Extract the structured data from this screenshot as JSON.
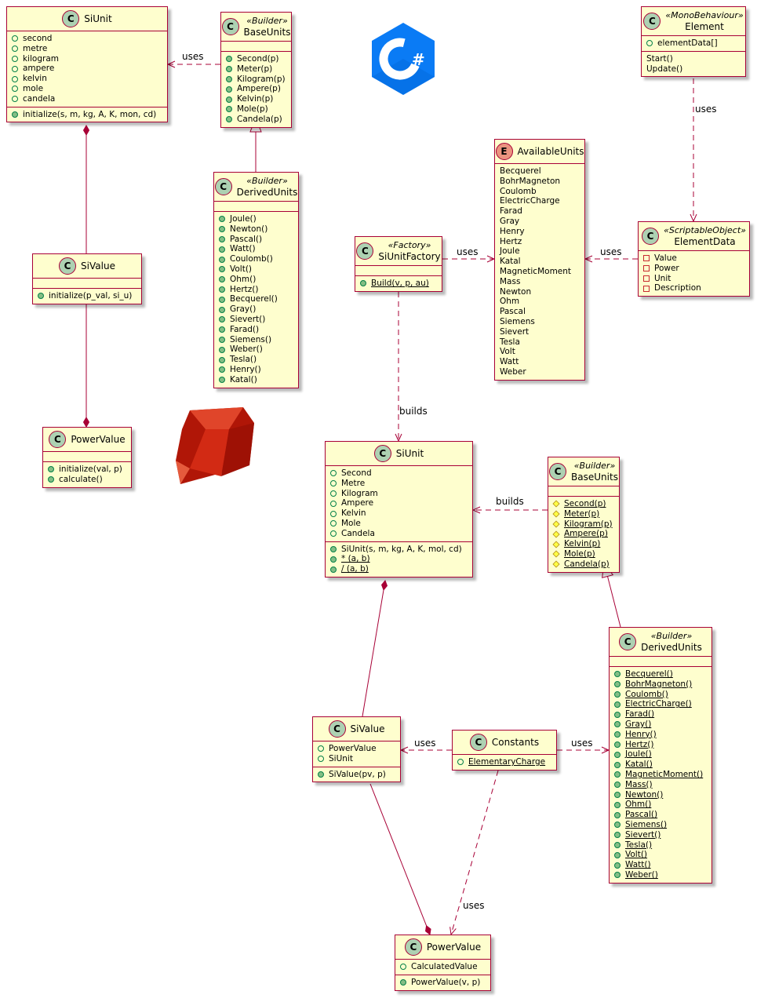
{
  "classes": [
    {
      "id": "ruby-siunit",
      "name": "SiUnit",
      "stereotype": "",
      "kind": "class",
      "fields": [
        {
          "vis": "+f",
          "text": "second"
        },
        {
          "vis": "+f",
          "text": "metre"
        },
        {
          "vis": "+f",
          "text": "kilogram"
        },
        {
          "vis": "+f",
          "text": "ampere"
        },
        {
          "vis": "+f",
          "text": "kelvin"
        },
        {
          "vis": "+f",
          "text": "mole"
        },
        {
          "vis": "+f",
          "text": "candela"
        }
      ],
      "methods": [
        {
          "vis": "+m",
          "text": "initialize(s, m, kg, A, K, mon, cd)"
        }
      ]
    },
    {
      "id": "ruby-baseunits",
      "name": "BaseUnits",
      "stereotype": "«Builder»",
      "kind": "class",
      "fields": null,
      "methods": [
        {
          "vis": "+m",
          "text": "Second(p)"
        },
        {
          "vis": "+m",
          "text": "Meter(p)"
        },
        {
          "vis": "+m",
          "text": "Kilogram(p)"
        },
        {
          "vis": "+m",
          "text": "Ampere(p)"
        },
        {
          "vis": "+m",
          "text": "Kelvin(p)"
        },
        {
          "vis": "+m",
          "text": "Mole(p)"
        },
        {
          "vis": "+m",
          "text": "Candela(p)"
        }
      ]
    },
    {
      "id": "ruby-derivedunits",
      "name": "DerivedUnits",
      "stereotype": "«Builder»",
      "kind": "class",
      "fields": null,
      "methods": [
        {
          "vis": "+m",
          "text": "Joule()"
        },
        {
          "vis": "+m",
          "text": "Newton()"
        },
        {
          "vis": "+m",
          "text": "Pascal()"
        },
        {
          "vis": "+m",
          "text": "Watt()"
        },
        {
          "vis": "+m",
          "text": "Coulomb()"
        },
        {
          "vis": "+m",
          "text": "Volt()"
        },
        {
          "vis": "+m",
          "text": "Ohm()"
        },
        {
          "vis": "+m",
          "text": "Hertz()"
        },
        {
          "vis": "+m",
          "text": "Becquerel()"
        },
        {
          "vis": "+m",
          "text": "Gray()"
        },
        {
          "vis": "+m",
          "text": "Sievert()"
        },
        {
          "vis": "+m",
          "text": "Farad()"
        },
        {
          "vis": "+m",
          "text": "Siemens()"
        },
        {
          "vis": "+m",
          "text": "Weber()"
        },
        {
          "vis": "+m",
          "text": "Tesla()"
        },
        {
          "vis": "+m",
          "text": "Henry()"
        },
        {
          "vis": "+m",
          "text": "Katal()"
        }
      ]
    },
    {
      "id": "ruby-sivalue",
      "name": "SiValue",
      "stereotype": "",
      "kind": "class",
      "fields": null,
      "methods": [
        {
          "vis": "+m",
          "text": "initialize(p_val, si_u)"
        }
      ]
    },
    {
      "id": "ruby-powervalue",
      "name": "PowerValue",
      "stereotype": "",
      "kind": "class",
      "fields": [],
      "methods": [
        {
          "vis": "+m",
          "text": "initialize(val, p)"
        },
        {
          "vis": "+m",
          "text": "calculate()"
        }
      ]
    },
    {
      "id": "element",
      "name": "Element",
      "stereotype": "«MonoBehaviour»",
      "kind": "class",
      "fields": [
        {
          "vis": "+f",
          "text": "elementData[]"
        }
      ],
      "methods": [
        {
          "vis": "",
          "text": "Start()"
        },
        {
          "vis": "",
          "text": "Update()"
        }
      ]
    },
    {
      "id": "availableunits",
      "name": "AvailableUnits",
      "stereotype": "",
      "kind": "enum",
      "fields": [
        {
          "vis": "",
          "text": "Becquerel"
        },
        {
          "vis": "",
          "text": "BohrMagneton"
        },
        {
          "vis": "",
          "text": "Coulomb"
        },
        {
          "vis": "",
          "text": "ElectricCharge"
        },
        {
          "vis": "",
          "text": "Farad"
        },
        {
          "vis": "",
          "text": "Gray"
        },
        {
          "vis": "",
          "text": "Henry"
        },
        {
          "vis": "",
          "text": "Hertz"
        },
        {
          "vis": "",
          "text": "Joule"
        },
        {
          "vis": "",
          "text": "Katal"
        },
        {
          "vis": "",
          "text": "MagneticMoment"
        },
        {
          "vis": "",
          "text": "Mass"
        },
        {
          "vis": "",
          "text": "Newton"
        },
        {
          "vis": "",
          "text": "Ohm"
        },
        {
          "vis": "",
          "text": "Pascal"
        },
        {
          "vis": "",
          "text": "Siemens"
        },
        {
          "vis": "",
          "text": "Sievert"
        },
        {
          "vis": "",
          "text": "Tesla"
        },
        {
          "vis": "",
          "text": "Volt"
        },
        {
          "vis": "",
          "text": "Watt"
        },
        {
          "vis": "",
          "text": "Weber"
        }
      ],
      "methods": null
    },
    {
      "id": "siunitfactory",
      "name": "SiUnitFactory",
      "stereotype": "«Factory»",
      "kind": "class",
      "fields": null,
      "methods": [
        {
          "vis": "+m",
          "text": "Build(v, p, au)",
          "static": true
        }
      ]
    },
    {
      "id": "elementdata",
      "name": "ElementData",
      "stereotype": "«ScriptableObject»",
      "kind": "class",
      "fields": [
        {
          "vis": "-f",
          "text": "Value"
        },
        {
          "vis": "-f",
          "text": "Power"
        },
        {
          "vis": "-f",
          "text": "Unit"
        },
        {
          "vis": "-f",
          "text": "Description"
        }
      ],
      "methods": null
    },
    {
      "id": "cs-siunit",
      "name": "SiUnit",
      "stereotype": "",
      "kind": "class",
      "fields": [
        {
          "vis": "+f",
          "text": "Second"
        },
        {
          "vis": "+f",
          "text": "Metre"
        },
        {
          "vis": "+f",
          "text": "Kilogram"
        },
        {
          "vis": "+f",
          "text": "Ampere"
        },
        {
          "vis": "+f",
          "text": "Kelvin"
        },
        {
          "vis": "+f",
          "text": "Mole"
        },
        {
          "vis": "+f",
          "text": "Candela"
        }
      ],
      "methods": [
        {
          "vis": "+m",
          "text": "SiUnit(s, m, kg, A, K, mol, cd)"
        },
        {
          "vis": "+m",
          "text": "* (a, b)",
          "static": true
        },
        {
          "vis": "+m",
          "text": "/ (a, b)",
          "static": true
        }
      ]
    },
    {
      "id": "cs-baseunits",
      "name": "BaseUnits",
      "stereotype": "«Builder»",
      "kind": "class",
      "fields": null,
      "methods": [
        {
          "vis": "#m",
          "text": "Second(p)",
          "static": true
        },
        {
          "vis": "#m",
          "text": "Meter(p)",
          "static": true
        },
        {
          "vis": "#m",
          "text": "Kilogram(p)",
          "static": true
        },
        {
          "vis": "#m",
          "text": "Ampere(p)",
          "static": true
        },
        {
          "vis": "#m",
          "text": "Kelvin(p)",
          "static": true
        },
        {
          "vis": "#m",
          "text": "Mole(p)",
          "static": true
        },
        {
          "vis": "#m",
          "text": "Candela(p)",
          "static": true
        }
      ]
    },
    {
      "id": "cs-derivedunits",
      "name": "DerivedUnits",
      "stereotype": "«Builder»",
      "kind": "class",
      "fields": null,
      "methods": [
        {
          "vis": "+m",
          "text": "Becquerel()",
          "static": true
        },
        {
          "vis": "+m",
          "text": "BohrMagneton()",
          "static": true
        },
        {
          "vis": "+m",
          "text": "Coulomb()",
          "static": true
        },
        {
          "vis": "+m",
          "text": "ElectricCharge()",
          "static": true
        },
        {
          "vis": "+m",
          "text": "Farad()",
          "static": true
        },
        {
          "vis": "+m",
          "text": "Gray()",
          "static": true
        },
        {
          "vis": "+m",
          "text": "Henry()",
          "static": true
        },
        {
          "vis": "+m",
          "text": "Hertz()",
          "static": true
        },
        {
          "vis": "+m",
          "text": "Joule()",
          "static": true
        },
        {
          "vis": "+m",
          "text": "Katal()",
          "static": true
        },
        {
          "vis": "+m",
          "text": "MagneticMoment()",
          "static": true
        },
        {
          "vis": "+m",
          "text": "Mass()",
          "static": true
        },
        {
          "vis": "+m",
          "text": "Newton()",
          "static": true
        },
        {
          "vis": "+m",
          "text": "Ohm()",
          "static": true
        },
        {
          "vis": "+m",
          "text": "Pascal()",
          "static": true
        },
        {
          "vis": "+m",
          "text": "Siemens()",
          "static": true
        },
        {
          "vis": "+m",
          "text": "Sievert()",
          "static": true
        },
        {
          "vis": "+m",
          "text": "Tesla()",
          "static": true
        },
        {
          "vis": "+m",
          "text": "Volt()",
          "static": true
        },
        {
          "vis": "+m",
          "text": "Watt()",
          "static": true
        },
        {
          "vis": "+m",
          "text": "Weber()",
          "static": true
        }
      ]
    },
    {
      "id": "cs-sivalue",
      "name": "SiValue",
      "stereotype": "",
      "kind": "class",
      "fields": [
        {
          "vis": "+f",
          "text": "PowerValue"
        },
        {
          "vis": "+f",
          "text": "SiUnit"
        }
      ],
      "methods": [
        {
          "vis": "+m",
          "text": "SiValue(pv, p)"
        }
      ]
    },
    {
      "id": "constants",
      "name": "Constants",
      "stereotype": "",
      "kind": "class",
      "fields": [
        {
          "vis": "+f",
          "text": "ElementaryCharge",
          "static": true
        }
      ],
      "methods": null
    },
    {
      "id": "cs-powervalue",
      "name": "PowerValue",
      "stereotype": "",
      "kind": "class",
      "fields": [
        {
          "vis": "+f",
          "text": "CalculatedValue"
        }
      ],
      "methods": [
        {
          "vis": "+m",
          "text": "PowerValue(v, p)"
        }
      ]
    }
  ],
  "edges": [
    {
      "from": "ruby-baseunits",
      "to": "ruby-siunit",
      "type": "dependency",
      "label": "uses"
    },
    {
      "from": "ruby-derivedunits",
      "to": "ruby-baseunits",
      "type": "inheritance",
      "label": ""
    },
    {
      "from": "ruby-sivalue",
      "to": "ruby-siunit",
      "type": "composition",
      "label": ""
    },
    {
      "from": "ruby-sivalue",
      "to": "ruby-powervalue",
      "type": "composition",
      "label": ""
    },
    {
      "from": "element",
      "to": "elementdata",
      "type": "dependency",
      "label": "uses"
    },
    {
      "from": "elementdata",
      "to": "availableunits",
      "type": "dependency",
      "label": "uses"
    },
    {
      "from": "siunitfactory",
      "to": "availableunits",
      "type": "dependency",
      "label": "uses"
    },
    {
      "from": "siunitfactory",
      "to": "cs-siunit",
      "type": "dependency",
      "label": "builds"
    },
    {
      "from": "cs-baseunits",
      "to": "cs-siunit",
      "type": "dependency",
      "label": "builds"
    },
    {
      "from": "cs-derivedunits",
      "to": "cs-baseunits",
      "type": "inheritance",
      "label": ""
    },
    {
      "from": "cs-sivalue",
      "to": "cs-siunit",
      "type": "composition",
      "label": ""
    },
    {
      "from": "constants",
      "to": "cs-sivalue",
      "type": "dependency",
      "label": "uses"
    },
    {
      "from": "constants",
      "to": "cs-derivedunits",
      "type": "dependency",
      "label": "uses"
    },
    {
      "from": "constants",
      "to": "cs-powervalue",
      "type": "dependency",
      "label": "uses"
    },
    {
      "from": "cs-sivalue",
      "to": "cs-powervalue",
      "type": "composition",
      "label": ""
    }
  ],
  "logos": {
    "csharp": {
      "text": "C#",
      "color": "#0A7BF5"
    },
    "ruby": {
      "color": "#C41A0E"
    }
  },
  "colors": {
    "border": "#A80036",
    "fill": "#FEFECE",
    "badge": "#ADD1B2"
  }
}
